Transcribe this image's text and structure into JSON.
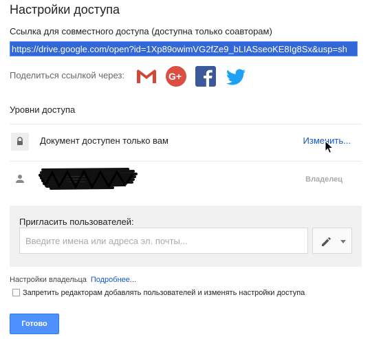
{
  "dialog": {
    "title": "Настройки доступа"
  },
  "share_link": {
    "label": "Ссылка для совместного доступа (доступна только соавторам)",
    "value": "https://drive.google.com/open?id=1Xp89owimVG2fZe9_bLIASseoKE8Ig8Sx&usp=sh"
  },
  "share_via": {
    "label": "Поделиться ссылкой через:",
    "services": [
      {
        "name": "gmail-icon",
        "color": "#d44638"
      },
      {
        "name": "google-plus-icon",
        "color": "#dc4e41"
      },
      {
        "name": "facebook-icon",
        "color": "#3b5998"
      },
      {
        "name": "twitter-icon",
        "color": "#1da1f2"
      }
    ]
  },
  "access_levels": {
    "label": "Уровни доступа",
    "visibility": {
      "icon": "lock-icon",
      "text": "Документ доступен только вам",
      "action": "Изменить..."
    },
    "owner": {
      "icon": "person-icon",
      "role": "Владелец"
    }
  },
  "invite": {
    "label": "Пригласить пользователей:",
    "placeholder": "Введите имена или адреса эл. почты...",
    "permission_icon": "pencil-icon"
  },
  "owner_settings": {
    "label": "Настройки владельца",
    "more_link": "Подробнее...",
    "restrict_label": "Запретить редакторам добавлять пользователей и изменять настройки доступа",
    "restrict_checked": false
  },
  "footer": {
    "done_label": "Готово"
  },
  "colors": {
    "accent": "#4d90fe",
    "link": "#1155cc"
  }
}
